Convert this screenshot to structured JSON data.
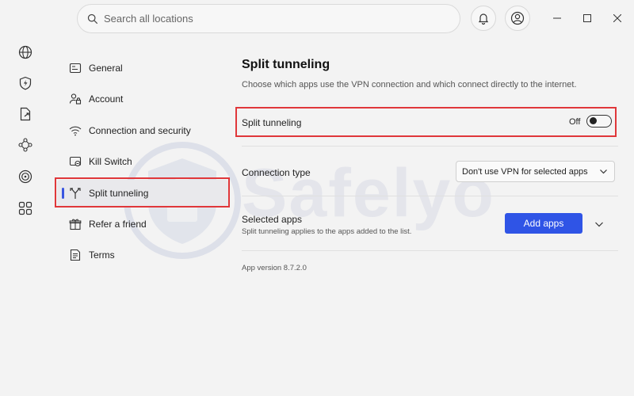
{
  "search": {
    "placeholder": "Search all locations"
  },
  "header": {
    "icons": [
      "bell-icon",
      "account-icon",
      "minimize-icon",
      "maximize-icon",
      "close-icon"
    ]
  },
  "rail": {
    "icons": [
      "globe-icon",
      "shield-bolt-icon",
      "file-share-icon",
      "network-icon",
      "target-icon",
      "apps-grid-icon"
    ]
  },
  "nav": {
    "items": [
      {
        "label": "General",
        "icon": "settings-list-icon"
      },
      {
        "label": "Account",
        "icon": "user-lock-icon"
      },
      {
        "label": "Connection and security",
        "icon": "wifi-icon"
      },
      {
        "label": "Kill Switch",
        "icon": "kill-switch-icon"
      },
      {
        "label": "Split tunneling",
        "icon": "split-icon",
        "active": true
      },
      {
        "label": "Refer a friend",
        "icon": "gift-icon"
      },
      {
        "label": "Terms",
        "icon": "document-icon"
      }
    ]
  },
  "main": {
    "title": "Split tunneling",
    "subtitle": "Choose which apps use the VPN connection and which connect directly to the internet.",
    "split_tunneling": {
      "label": "Split tunneling",
      "state": "Off"
    },
    "connection_type": {
      "label": "Connection type",
      "value": "Don't use VPN for selected apps"
    },
    "selected_apps": {
      "label": "Selected apps",
      "hint": "Split tunneling applies to the apps added to the list.",
      "button": "Add apps"
    },
    "version": "App version 8.7.2.0"
  },
  "watermark": "Safelyo",
  "colors": {
    "accent": "#2f54e6",
    "highlight": "#e0373a",
    "background": "#f3f3f3"
  }
}
